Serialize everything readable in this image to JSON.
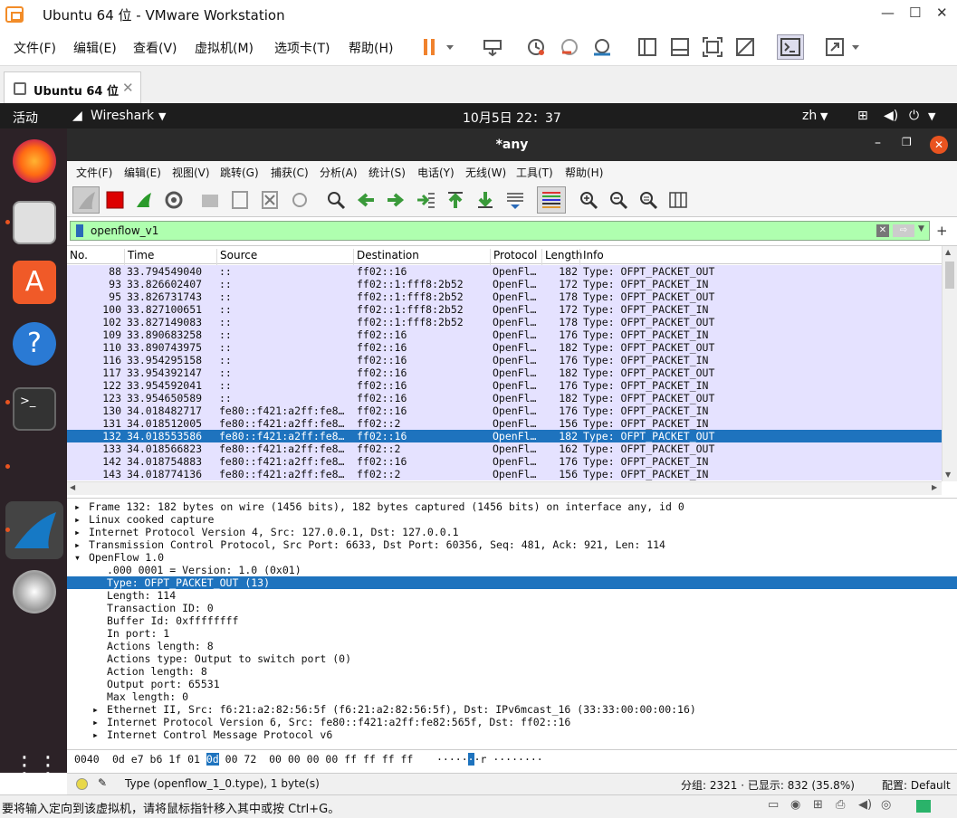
{
  "vm": {
    "title": "Ubuntu 64 位 - VMware Workstation",
    "menu": [
      "文件(F)",
      "编辑(E)",
      "查看(V)",
      "虚拟机(M)",
      "选项卡(T)",
      "帮助(H)"
    ],
    "tab_label": "Ubuntu 64 位",
    "status_text": "要将输入定向到该虚拟机，请将鼠标指针移入其中或按 Ctrl+G。"
  },
  "ubuntu": {
    "activities": "活动",
    "app_name": "Wireshark",
    "clock": "10月5日  22：37",
    "lang": "zh"
  },
  "ws": {
    "title": "*any",
    "menu": [
      "文件(F)",
      "编辑(E)",
      "视图(V)",
      "跳转(G)",
      "捕获(C)",
      "分析(A)",
      "统计(S)",
      "电话(Y)",
      "无线(W)",
      "工具(T)",
      "帮助(H)"
    ],
    "filter": "openflow_v1",
    "columns": [
      "No.",
      "Time",
      "Source",
      "Destination",
      "Protocol",
      "Length",
      "Info"
    ],
    "packets": [
      {
        "no": "88",
        "time": "33.794549040",
        "src": "::",
        "dst": "ff02::16",
        "proto": "OpenFl…",
        "len": "182",
        "info": "Type: OFPT_PACKET_OUT"
      },
      {
        "no": "93",
        "time": "33.826602407",
        "src": "::",
        "dst": "ff02::1:fff8:2b52",
        "proto": "OpenFl…",
        "len": "172",
        "info": "Type: OFPT_PACKET_IN"
      },
      {
        "no": "95",
        "time": "33.826731743",
        "src": "::",
        "dst": "ff02::1:fff8:2b52",
        "proto": "OpenFl…",
        "len": "178",
        "info": "Type: OFPT_PACKET_OUT"
      },
      {
        "no": "100",
        "time": "33.827100651",
        "src": "::",
        "dst": "ff02::1:fff8:2b52",
        "proto": "OpenFl…",
        "len": "172",
        "info": "Type: OFPT_PACKET_IN"
      },
      {
        "no": "102",
        "time": "33.827149083",
        "src": "::",
        "dst": "ff02::1:fff8:2b52",
        "proto": "OpenFl…",
        "len": "178",
        "info": "Type: OFPT_PACKET_OUT"
      },
      {
        "no": "109",
        "time": "33.890683258",
        "src": "::",
        "dst": "ff02::16",
        "proto": "OpenFl…",
        "len": "176",
        "info": "Type: OFPT_PACKET_IN"
      },
      {
        "no": "110",
        "time": "33.890743975",
        "src": "::",
        "dst": "ff02::16",
        "proto": "OpenFl…",
        "len": "182",
        "info": "Type: OFPT_PACKET_OUT"
      },
      {
        "no": "116",
        "time": "33.954295158",
        "src": "::",
        "dst": "ff02::16",
        "proto": "OpenFl…",
        "len": "176",
        "info": "Type: OFPT_PACKET_IN"
      },
      {
        "no": "117",
        "time": "33.954392147",
        "src": "::",
        "dst": "ff02::16",
        "proto": "OpenFl…",
        "len": "182",
        "info": "Type: OFPT_PACKET_OUT"
      },
      {
        "no": "122",
        "time": "33.954592041",
        "src": "::",
        "dst": "ff02::16",
        "proto": "OpenFl…",
        "len": "176",
        "info": "Type: OFPT_PACKET_IN"
      },
      {
        "no": "123",
        "time": "33.954650589",
        "src": "::",
        "dst": "ff02::16",
        "proto": "OpenFl…",
        "len": "182",
        "info": "Type: OFPT_PACKET_OUT"
      },
      {
        "no": "130",
        "time": "34.018482717",
        "src": "fe80::f421:a2ff:fe8…",
        "dst": "ff02::16",
        "proto": "OpenFl…",
        "len": "176",
        "info": "Type: OFPT_PACKET_IN"
      },
      {
        "no": "131",
        "time": "34.018512005",
        "src": "fe80::f421:a2ff:fe8…",
        "dst": "ff02::2",
        "proto": "OpenFl…",
        "len": "156",
        "info": "Type: OFPT_PACKET_IN"
      },
      {
        "no": "132",
        "time": "34.018553586",
        "src": "fe80::f421:a2ff:fe8…",
        "dst": "ff02::16",
        "proto": "OpenFl…",
        "len": "182",
        "info": "Type: OFPT_PACKET_OUT"
      },
      {
        "no": "133",
        "time": "34.018566823",
        "src": "fe80::f421:a2ff:fe8…",
        "dst": "ff02::2",
        "proto": "OpenFl…",
        "len": "162",
        "info": "Type: OFPT_PACKET_OUT"
      },
      {
        "no": "142",
        "time": "34.018754883",
        "src": "fe80::f421:a2ff:fe8…",
        "dst": "ff02::16",
        "proto": "OpenFl…",
        "len": "176",
        "info": "Type: OFPT_PACKET_IN"
      },
      {
        "no": "143",
        "time": "34.018774136",
        "src": "fe80::f421:a2ff:fe8…",
        "dst": "ff02::2",
        "proto": "OpenFl…",
        "len": "156",
        "info": "Type: OFPT_PACKET_IN"
      }
    ],
    "details": [
      {
        "indent": 0,
        "arrow": "▸",
        "text": "Frame 132: 182 bytes on wire (1456 bits), 182 bytes captured (1456 bits) on interface any, id 0"
      },
      {
        "indent": 0,
        "arrow": "▸",
        "text": "Linux cooked capture"
      },
      {
        "indent": 0,
        "arrow": "▸",
        "text": "Internet Protocol Version 4, Src: 127.0.0.1, Dst: 127.0.0.1"
      },
      {
        "indent": 0,
        "arrow": "▸",
        "text": "Transmission Control Protocol, Src Port: 6633, Dst Port: 60356, Seq: 481, Ack: 921, Len: 114"
      },
      {
        "indent": 0,
        "arrow": "▾",
        "text": "OpenFlow 1.0"
      },
      {
        "indent": 1,
        "arrow": "",
        "text": ".000 0001 = Version: 1.0 (0x01)"
      },
      {
        "indent": 1,
        "arrow": "",
        "text": "Type: OFPT_PACKET_OUT (13)"
      },
      {
        "indent": 1,
        "arrow": "",
        "text": "Length: 114"
      },
      {
        "indent": 1,
        "arrow": "",
        "text": "Transaction ID: 0"
      },
      {
        "indent": 1,
        "arrow": "",
        "text": "Buffer Id: 0xffffffff"
      },
      {
        "indent": 1,
        "arrow": "",
        "text": "In port: 1"
      },
      {
        "indent": 1,
        "arrow": "",
        "text": "Actions length: 8"
      },
      {
        "indent": 1,
        "arrow": "",
        "text": "Actions type: Output to switch port (0)"
      },
      {
        "indent": 1,
        "arrow": "",
        "text": "Action length: 8"
      },
      {
        "indent": 1,
        "arrow": "",
        "text": "Output port: 65531"
      },
      {
        "indent": 1,
        "arrow": "",
        "text": "Max length: 0"
      },
      {
        "indent": 1,
        "arrow": "▸",
        "text": "Ethernet II, Src: f6:21:a2:82:56:5f (f6:21:a2:82:56:5f), Dst: IPv6mcast_16 (33:33:00:00:00:16)"
      },
      {
        "indent": 1,
        "arrow": "▸",
        "text": "Internet Protocol Version 6, Src: fe80::f421:a2ff:fe82:565f, Dst: ff02::16"
      },
      {
        "indent": 1,
        "arrow": "▸",
        "text": "Internet Control Message Protocol v6"
      }
    ],
    "bytes_offset": "0040",
    "bytes_hex_before": "0d e7 b6 1f 01 ",
    "bytes_hex_sel": "0d",
    "bytes_hex_after": " 00 72  00 00 00 00 ff ff ff ff",
    "bytes_ascii_before": "·····",
    "bytes_ascii_sel": "·",
    "bytes_ascii_after": "·r ········",
    "status_field": "Type (openflow_1_0.type), 1 byte(s)",
    "status_counts": "分组: 2321 · 已显示: 832 (35.8%)",
    "status_profile": "配置: Default"
  }
}
